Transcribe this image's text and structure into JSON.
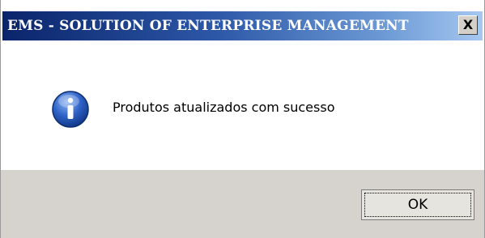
{
  "window": {
    "title": "EMS - SOLUTION OF ENTERPRISE MANAGEMENT",
    "close_label": "X"
  },
  "dialog": {
    "icon": "info-icon",
    "message": "Produtos atualizados com sucesso"
  },
  "buttons": {
    "ok_label": "OK"
  },
  "colors": {
    "title_bar_start": "#0a246a",
    "title_bar_end": "#a6c8f0",
    "footer_background": "#d6d3ce",
    "info_icon_blue": "#2f63c8"
  }
}
